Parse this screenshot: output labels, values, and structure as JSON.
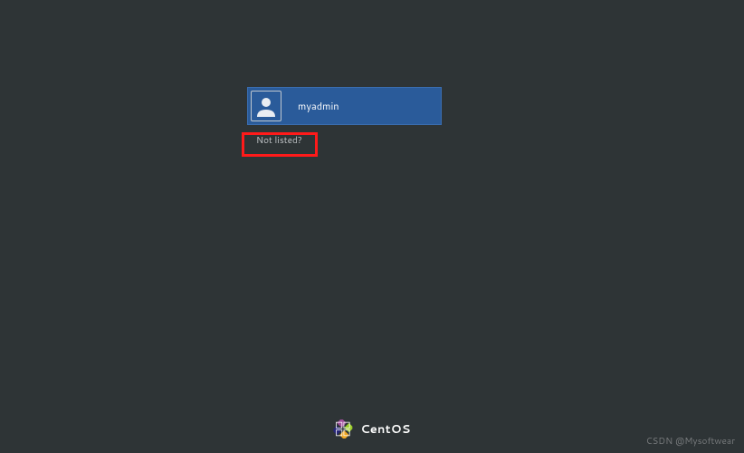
{
  "login": {
    "users": [
      {
        "name": "myadmin"
      }
    ],
    "not_listed_label": "Not listed?"
  },
  "branding": {
    "distro": "CentOS",
    "logo_colors": {
      "purple": "#a14f9d",
      "green": "#9ccd2a",
      "orange": "#efa724",
      "blue": "#262577"
    }
  },
  "annotation": {
    "highlight_color": "#ff1a1a"
  },
  "watermark": "CSDN @Mysoftwear"
}
